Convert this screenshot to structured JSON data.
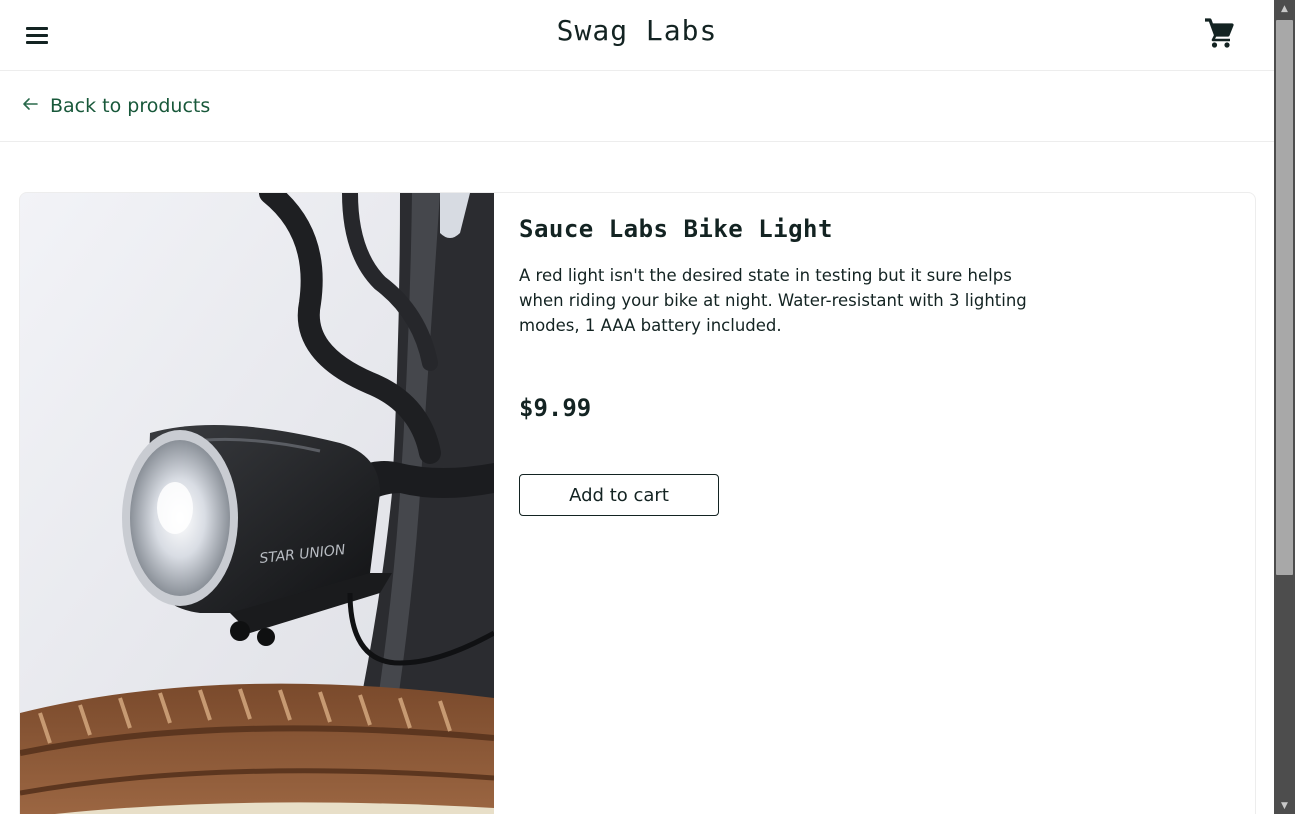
{
  "header": {
    "title": "Swag Labs",
    "menu_icon": "hamburger-menu-icon",
    "cart_icon": "shopping-cart-icon"
  },
  "sub_header": {
    "back_label": "Back to products",
    "back_icon": "arrow-left-icon"
  },
  "product": {
    "name": "Sauce Labs Bike Light",
    "description": "A red light isn't the desired state in testing but it sure helps when riding your bike at night. Water-resistant with 3 lighting modes, 1 AAA battery included.",
    "price": "$9.99",
    "add_to_cart_label": "Add to cart",
    "image_brand_text": "STAR UNION"
  },
  "colors": {
    "text": "#132322",
    "link": "#18583a",
    "border": "#ededed"
  }
}
